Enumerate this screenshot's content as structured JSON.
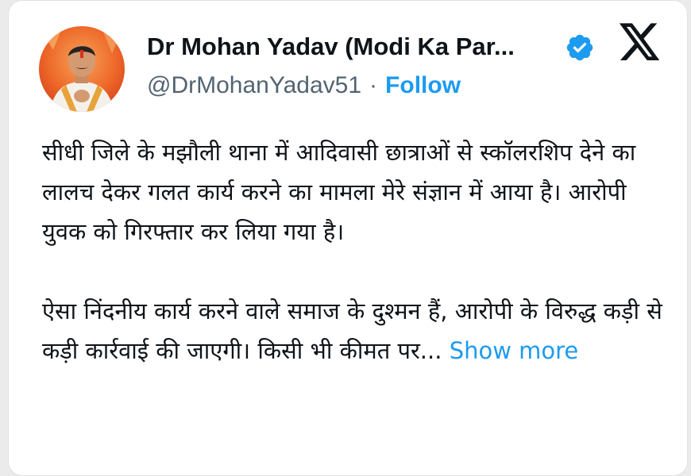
{
  "tweet": {
    "display_name": "Dr Mohan Yadav (Modi Ka Par...",
    "handle": "@DrMohanYadav51",
    "separator": "·",
    "follow_label": "Follow",
    "paragraph_1": "सीधी जिले के मझौली थाना में आदिवासी छात्राओं से स्कॉलरशिप देने का लालच देकर गलत कार्य करने का मामला मेरे संज्ञान में आया है। आरोपी युवक को गिरफ्तार कर लिया गया है।",
    "paragraph_2": "ऐसा निंदनीय कार्य करने वाले समाज के दुश्मन हैं, आरोपी के विरुद्ध कड़ी से कड़ी कार्रवाई की जाएगी। किसी भी कीमत पर...",
    "show_more_label": "Show more"
  },
  "icons": {
    "verified": "verified-badge-icon",
    "platform": "x-logo-icon"
  },
  "colors": {
    "accent": "#1d9bf0",
    "text": "#0f1419",
    "secondary": "#536471"
  }
}
